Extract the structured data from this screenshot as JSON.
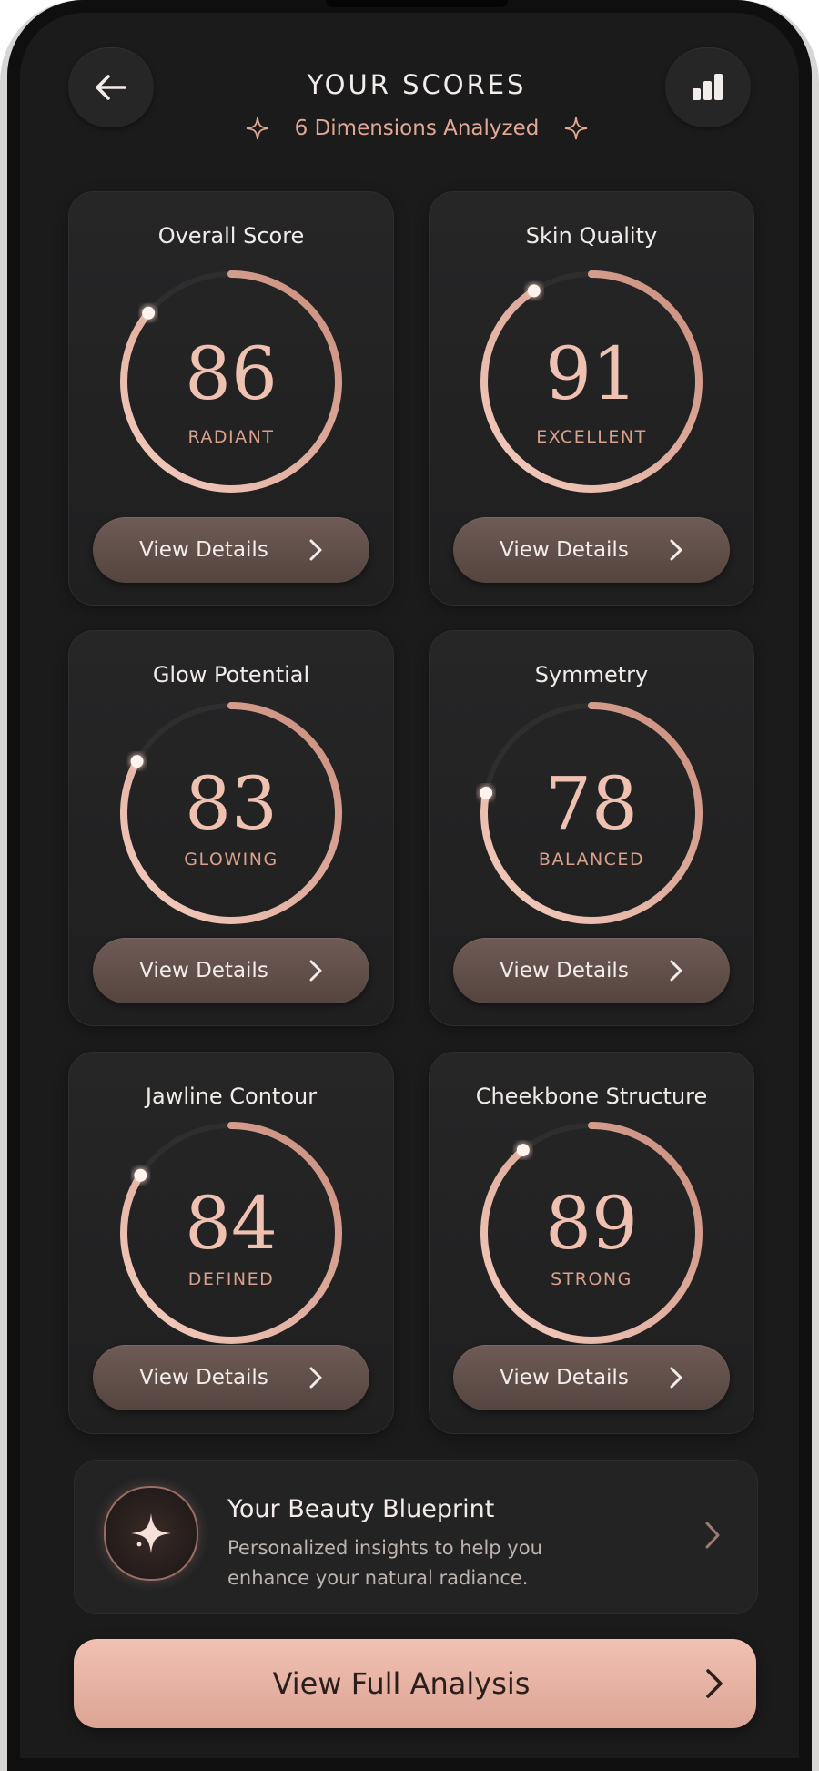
{
  "header": {
    "title": "YOUR SCORES",
    "subtitle": "6 Dimensions Analyzed",
    "back_icon": "back-arrow-icon",
    "stats_icon": "bar-chart-icon"
  },
  "colors": {
    "background": "#1b1b1c",
    "card": "#262627",
    "accent": "#e2a893",
    "score_text": "#efc1b1",
    "button": "#5f4c47",
    "cta": "#e8b4a5"
  },
  "cards": [
    {
      "title": "Overall Score",
      "score": "86",
      "label": "RADIANT",
      "button": "View Details",
      "ring_fill": 0.86
    },
    {
      "title": "Skin Quality",
      "score": "91",
      "label": "EXCELLENT",
      "button": "View Details",
      "ring_fill": 0.91
    },
    {
      "title": "Glow Potential",
      "score": "83",
      "label": "GLOWING",
      "button": "View Details",
      "ring_fill": 0.83
    },
    {
      "title": "Symmetry",
      "score": "78",
      "label": "BALANCED",
      "button": "View Details",
      "ring_fill": 0.78
    },
    {
      "title": "Jawline Contour",
      "score": "84",
      "label": "DEFINED",
      "button": "View Details",
      "ring_fill": 0.84
    },
    {
      "title": "Cheekbone Structure",
      "score": "89",
      "label": "STRONG",
      "button": "View Details",
      "ring_fill": 0.89
    }
  ],
  "blueprint": {
    "title": "Your Beauty Blueprint",
    "description": "Personalized insights to help you enhance your natural radiance.",
    "icon": "sparkle-icon"
  },
  "cta": {
    "label": "View Full Analysis"
  }
}
